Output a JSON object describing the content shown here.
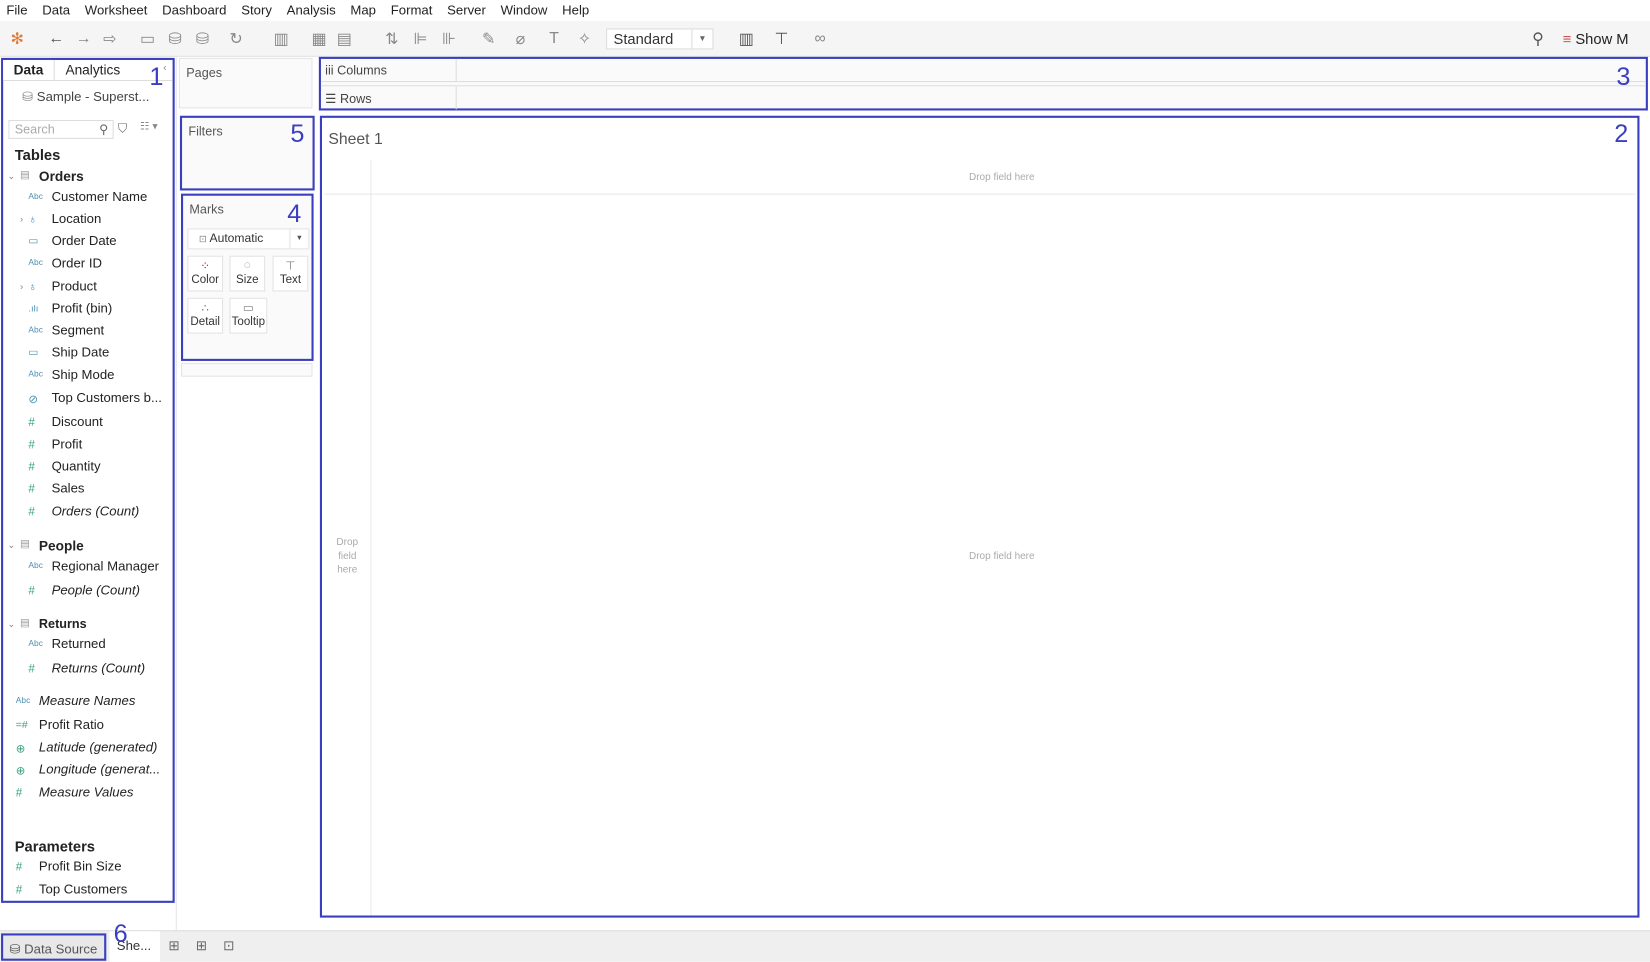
{
  "menu": [
    "File",
    "Data",
    "Worksheet",
    "Dashboard",
    "Story",
    "Analysis",
    "Map",
    "Format",
    "Server",
    "Window",
    "Help"
  ],
  "toolbar": {
    "mark_type_select": "Standard",
    "show_me": "Show M"
  },
  "left_panel": {
    "tabs": [
      "Data",
      "Analytics"
    ],
    "datasource": "Sample - Superst...",
    "search_placeholder": "Search",
    "tables_header": "Tables",
    "groups": [
      {
        "name": "Orders",
        "fields": [
          {
            "name": "Customer Name",
            "icon": "abc"
          },
          {
            "name": "Location",
            "icon": "hierarchy"
          },
          {
            "name": "Order Date",
            "icon": "calendar"
          },
          {
            "name": "Order ID",
            "icon": "abc"
          },
          {
            "name": "Product",
            "icon": "hierarchy"
          },
          {
            "name": "Profit (bin)",
            "icon": "bin"
          },
          {
            "name": "Segment",
            "icon": "abc"
          },
          {
            "name": "Ship Date",
            "icon": "calendar"
          },
          {
            "name": "Ship Mode",
            "icon": "abc"
          },
          {
            "name": "Top Customers b...",
            "icon": "set"
          },
          {
            "name": "Discount",
            "icon": "hash"
          },
          {
            "name": "Profit",
            "icon": "hash"
          },
          {
            "name": "Quantity",
            "icon": "hash"
          },
          {
            "name": "Sales",
            "icon": "hash"
          },
          {
            "name": "Orders (Count)",
            "icon": "hash"
          }
        ]
      },
      {
        "name": "People",
        "fields": [
          {
            "name": "Regional Manager",
            "icon": "abc"
          },
          {
            "name": "People (Count)",
            "icon": "hash"
          }
        ]
      },
      {
        "name": "Returns",
        "fields": [
          {
            "name": "Returned",
            "icon": "abc"
          },
          {
            "name": "Returns (Count)",
            "icon": "hash"
          }
        ]
      }
    ],
    "extra_fields": [
      {
        "name": "Measure Names",
        "icon": "abc"
      },
      {
        "name": "Profit Ratio",
        "icon": "calc-hash"
      },
      {
        "name": "Latitude (generated)",
        "icon": "globe"
      },
      {
        "name": "Longitude (generat...",
        "icon": "globe"
      },
      {
        "name": "Measure Values",
        "icon": "hash"
      }
    ],
    "parameters_header": "Parameters",
    "parameters": [
      "Profit Bin Size",
      "Top Customers"
    ]
  },
  "cards": {
    "pages": "Pages",
    "filters": "Filters",
    "marks": "Marks",
    "mark_type": "Automatic",
    "mark_buttons": [
      "Color",
      "Size",
      "Text",
      "Detail",
      "Tooltip"
    ]
  },
  "shelves": {
    "columns": "Columns",
    "rows": "Rows"
  },
  "sheet": {
    "title": "Sheet 1",
    "drop_top": "Drop field here",
    "drop_left": "Drop field here",
    "drop_center": "Drop field here"
  },
  "annotations": [
    "1",
    "2",
    "3",
    "4",
    "5",
    "6"
  ],
  "bottom": {
    "data_source": "Data Source",
    "sheet_tab": "She..."
  },
  "colors": {
    "annotation": "#3a3fbf",
    "dimension": "#4a8fb4",
    "measure": "#3aa37c"
  }
}
